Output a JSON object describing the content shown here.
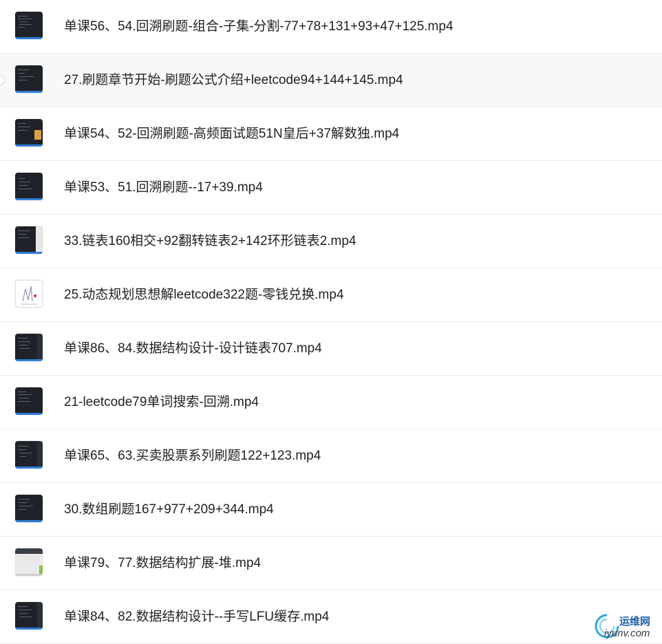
{
  "files": [
    {
      "name": "单课56、54.回溯刷题-组合-子集-分割-77+78+131+93+47+125.mp4",
      "thumb": "dark-code"
    },
    {
      "name": "27.刷题章节开始-刷题公式介绍+leetcode94+144+145.mp4",
      "thumb": "dark-code"
    },
    {
      "name": "单课54、52-回溯刷题-高频面试题51N皇后+37解数独.mp4",
      "thumb": "dark-chess"
    },
    {
      "name": "单课53、51.回溯刷题--17+39.mp4",
      "thumb": "dark-code"
    },
    {
      "name": "33.链表160相交+92翻转链表2+142环形链表2.mp4",
      "thumb": "dark-panel"
    },
    {
      "name": "25.动态规划思想解leetcode322题-零钱兑换.mp4",
      "thumb": "light-sketch"
    },
    {
      "name": "单课86、84.数据结构设计-设计链表707.mp4",
      "thumb": "dark-code"
    },
    {
      "name": "21-leetcode79单词搜索-回溯.mp4",
      "thumb": "dark-code"
    },
    {
      "name": "单课65、63.买卖股票系列刷题122+123.mp4",
      "thumb": "dark-code"
    },
    {
      "name": "30.数组刷题167+977+209+344.mp4",
      "thumb": "dark-code"
    },
    {
      "name": "单课79、77.数据结构扩展-堆.mp4",
      "thumb": "gray-window"
    },
    {
      "name": "单课84、82.数据结构设计--手写LFU缓存.mp4",
      "thumb": "dark-code"
    }
  ],
  "watermark": {
    "top": "运维网",
    "bottom": "iyunv.com"
  },
  "colors": {
    "accent": "#2f7ed8",
    "text": "#222222",
    "divider": "#ececec"
  }
}
